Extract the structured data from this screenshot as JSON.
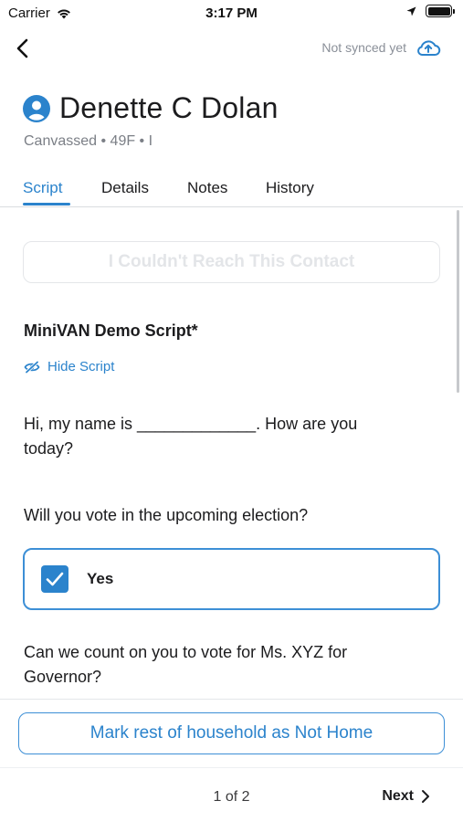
{
  "status_bar": {
    "carrier": "Carrier",
    "time": "3:17 PM",
    "battery_level": 1.0
  },
  "nav": {
    "sync_status": "Not synced yet",
    "back_icon": "chevron-left-icon",
    "sync_icon": "cloud-upload-icon"
  },
  "contact": {
    "name": "Denette C Dolan",
    "meta": "Canvassed • 49F • I",
    "avatar_icon": "person-circle-icon"
  },
  "tabs": [
    {
      "label": "Script",
      "active": true
    },
    {
      "label": "Details",
      "active": false
    },
    {
      "label": "Notes",
      "active": false
    },
    {
      "label": "History",
      "active": false
    }
  ],
  "script": {
    "unreachable_label": "I Couldn't Reach This Contact",
    "title": "MiniVAN Demo Script*",
    "hide_label": "Hide Script",
    "intro": "Hi, my name is _____________. How are you today?",
    "question1": "Will you vote in the upcoming election?",
    "answer1": {
      "label": "Yes",
      "checked": true
    },
    "question2": "Can we count on you to vote for Ms. XYZ for Governor?"
  },
  "footer": {
    "household_label": "Mark rest of household as Not Home",
    "pager": "1 of 2",
    "next_label": "Next"
  },
  "colors": {
    "accent": "#2b83cc",
    "text": "#1c1c1e",
    "muted": "#7b7f86"
  }
}
